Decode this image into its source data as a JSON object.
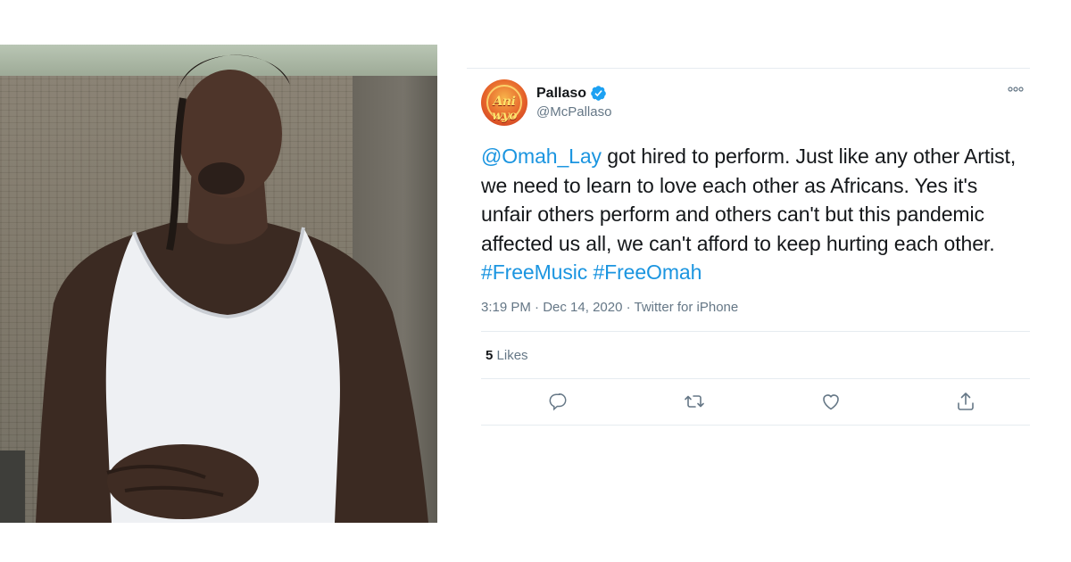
{
  "tweet": {
    "display_name": "Pallaso",
    "handle": "@McPallaso",
    "verified": true,
    "avatar_text": "Ani wyo",
    "text_segments": [
      {
        "text": "@Omah_Lay",
        "link": true
      },
      {
        "text": " got hired to perform. Just like any other Artist, we need to learn to love each other as Africans. Yes it's unfair others perform and others can't but this pandemic affected us all, we can't afford to keep hurting each other. ",
        "link": false
      },
      {
        "text": "#FreeMusic",
        "link": true
      },
      {
        "text": " ",
        "link": false
      },
      {
        "text": "#FreeOmah",
        "link": true
      }
    ],
    "time": "3:19 PM",
    "date": "Dec 14, 2020",
    "source": "Twitter for iPhone",
    "likes_count": "5",
    "likes_label": "Likes",
    "more_icon": "more-dots-icon",
    "actions": [
      {
        "name": "reply",
        "icon": "reply-icon"
      },
      {
        "name": "retweet",
        "icon": "retweet-icon"
      },
      {
        "name": "like",
        "icon": "heart-icon"
      },
      {
        "name": "share",
        "icon": "share-icon"
      }
    ]
  },
  "colors": {
    "link": "#1b95e0",
    "verified": "#1da1f2",
    "secondary_text": "#657786",
    "divider": "#e6ecf0"
  }
}
